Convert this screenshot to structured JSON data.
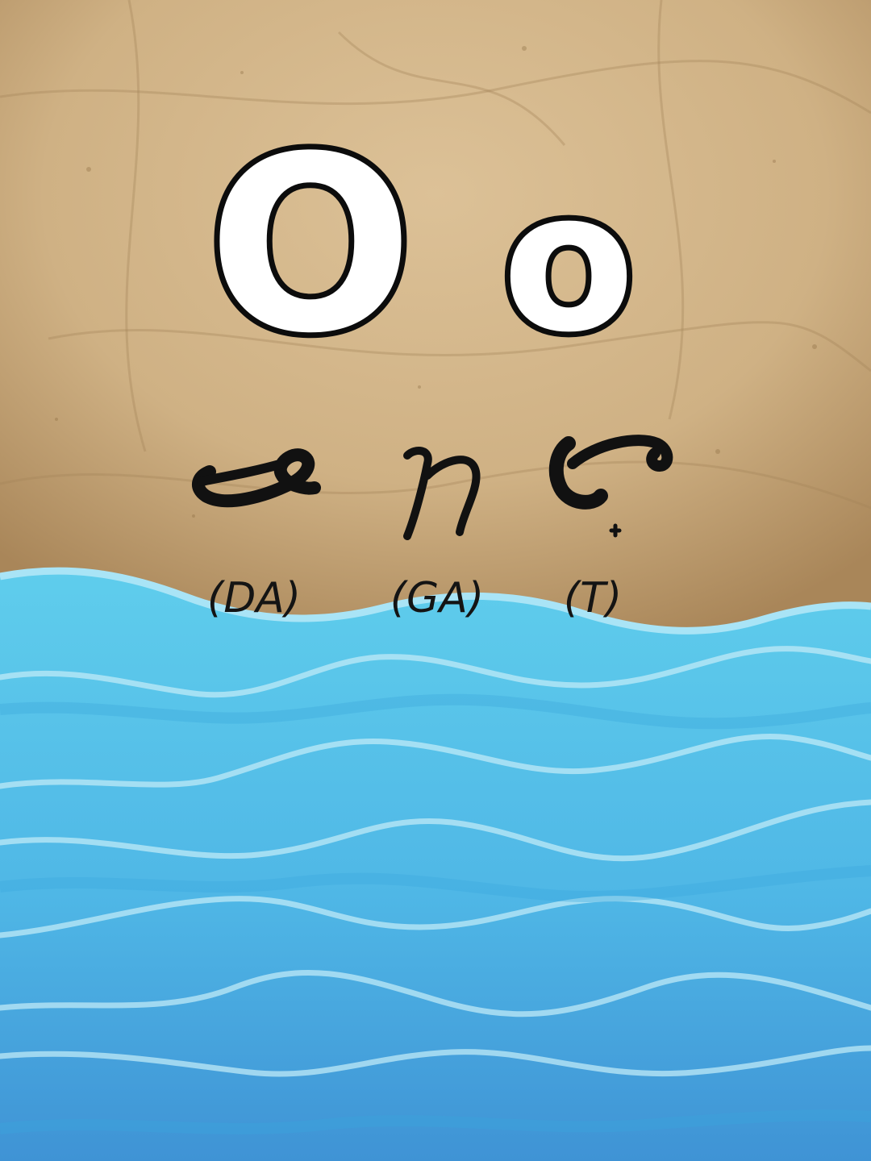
{
  "letter": {
    "upper": "O",
    "lower": "o"
  },
  "baybayin": [
    {
      "glyph": "baybayin-da",
      "romanization": "(DA)"
    },
    {
      "glyph": "baybayin-ga",
      "romanization": "(GA)"
    },
    {
      "glyph": "baybayin-ta-with-virama",
      "romanization": "(T)"
    }
  ],
  "colors": {
    "paper": "#d2b48c",
    "paper_dark": "#a98a5e",
    "sea_top": "#5ecbeb",
    "sea_bottom": "#3f96d6",
    "wave_highlight": "#bfe9f7",
    "ink": "#111111"
  }
}
